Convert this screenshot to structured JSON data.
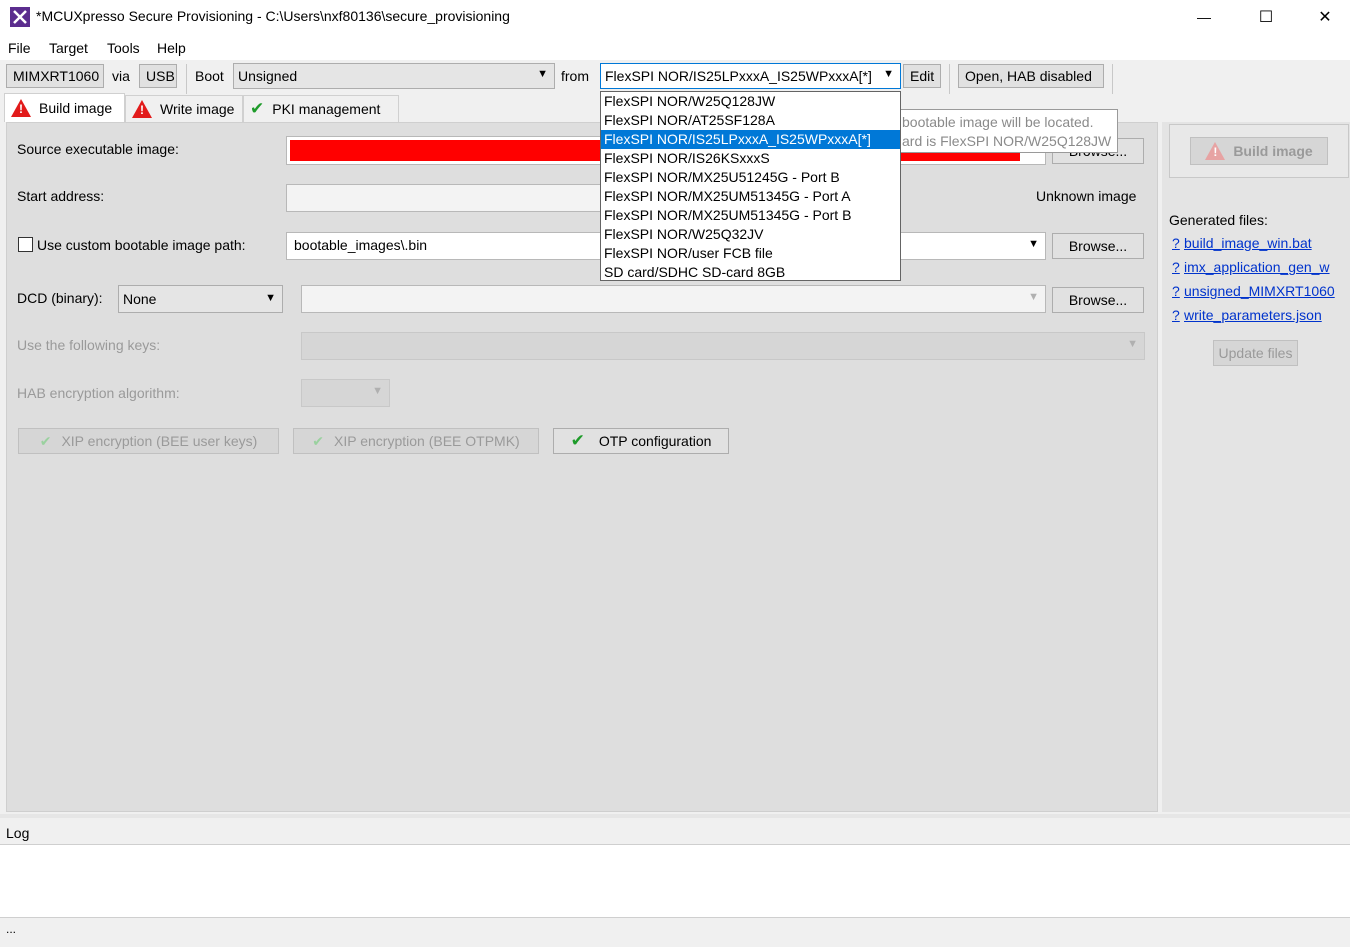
{
  "window": {
    "title": "*MCUXpresso Secure Provisioning - C:\\Users\\nxf80136\\secure_provisioning",
    "app_icon": "mcuxpresso-x-icon",
    "controls": {
      "minimize": "—",
      "maximize": "☐",
      "close": "✕"
    }
  },
  "menu": [
    "File",
    "Target",
    "Tools",
    "Help"
  ],
  "toolbar": {
    "device": "MIMXRT1060",
    "via_label": "via",
    "connection": "USB",
    "boot_label": "Boot",
    "boot_value": "Unsigned",
    "from_label": "from",
    "boot_memory": "FlexSPI NOR/IS25LPxxxA_IS25WPxxxA[*]",
    "edit_button": "Edit",
    "lifecycle_button": "Open, HAB disabled"
  },
  "tabs": [
    {
      "label": "Build image",
      "icon": "warning-icon",
      "active": true
    },
    {
      "label": "Write image",
      "icon": "warning-icon",
      "active": false
    },
    {
      "label": "PKI management",
      "icon": "check-icon",
      "active": false
    }
  ],
  "build": {
    "source_label": "Source executable image:",
    "source_browse": "Browse...",
    "start_address_label": "Start address:",
    "unknown_image": "Unknown image",
    "custom_path_label": "Use custom bootable image path:",
    "custom_path_value": "bootable_images\\.bin",
    "custom_browse": "Browse...",
    "dcd_label": "DCD (binary):",
    "dcd_value": "None",
    "dcd_browse": "Browse...",
    "keys_label": "Use the following keys:",
    "hab_label": "HAB encryption algorithm:",
    "xip_bee_user": "XIP encryption (BEE user keys)",
    "xip_bee_otpmk": "XIP encryption (BEE OTPMK)",
    "otp_config": "OTP configuration"
  },
  "tooltip": {
    "line1": "bootable image will be located.",
    "line2": "ard is FlexSPI NOR/W25Q128JW"
  },
  "boot_memory_options": [
    "FlexSPI NOR/W25Q128JW",
    "FlexSPI NOR/AT25SF128A",
    "FlexSPI NOR/IS25LPxxxA_IS25WPxxxA[*]",
    "FlexSPI NOR/IS26KSxxxS",
    "FlexSPI NOR/MX25U51245G - Port B",
    "FlexSPI NOR/MX25UM51345G - Port A",
    "FlexSPI NOR/MX25UM51345G - Port B",
    "FlexSPI NOR/W25Q32JV",
    "FlexSPI NOR/user FCB file",
    "SD card/SDHC SD-card 8GB"
  ],
  "selected_option_index": 2,
  "right_panel": {
    "build_button": "Build image",
    "generated_label": "Generated files:",
    "help_mark": "?",
    "files": [
      "build_image_win.bat",
      "imx_application_gen_w",
      "unsigned_MIMXRT1060",
      "write_parameters.json"
    ],
    "update_button": "Update files"
  },
  "log": {
    "label": "Log",
    "status": "..."
  },
  "colors": {
    "error_red": "#ff0000",
    "selection_blue": "#0078d7",
    "link_blue": "#0033cc",
    "warning_red": "#e21b1b",
    "check_green": "#1e9b2a"
  }
}
